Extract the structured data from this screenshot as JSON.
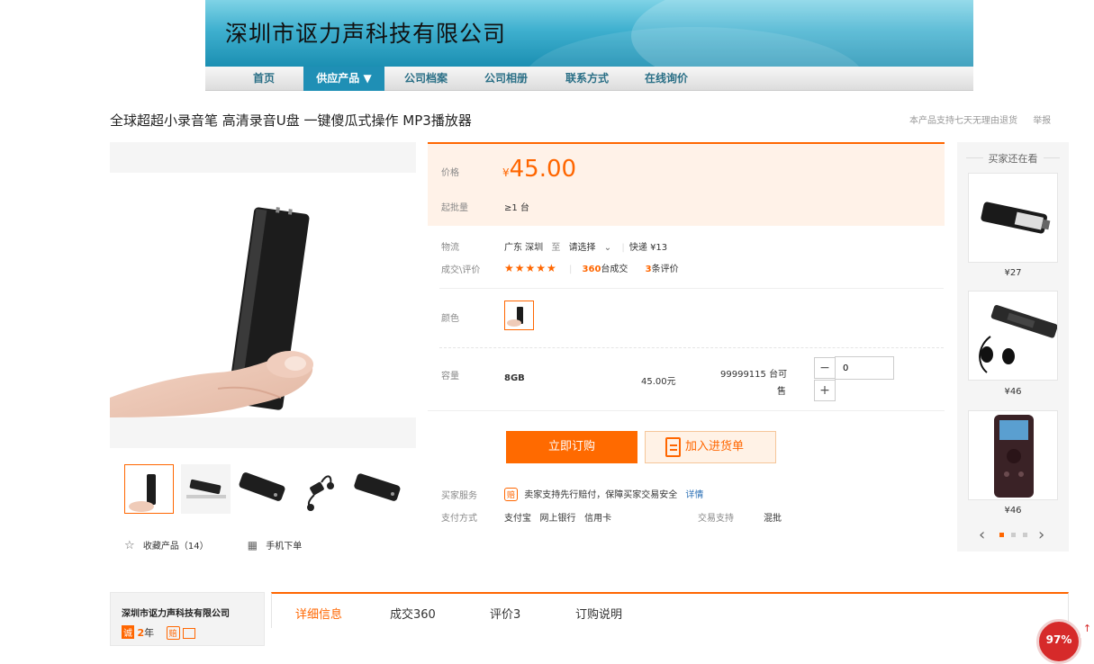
{
  "header": {
    "company_name": "深圳市讴力声科技有限公司",
    "nav": [
      {
        "label": "首页"
      },
      {
        "label": "供应产品 ▼"
      },
      {
        "label": "公司档案"
      },
      {
        "label": "公司相册"
      },
      {
        "label": "联系方式"
      },
      {
        "label": "在线询价"
      }
    ]
  },
  "product": {
    "title": "全球超超小录音笔 高清录音U盘 一键傻瓜式操作 MP3播放器",
    "return_policy": "本产品支持七天无理由退货",
    "report": "举报",
    "price_label": "价格",
    "currency": "¥",
    "price": "45.00",
    "moq_label": "起批量",
    "moq": "≥1 台",
    "logistics_label": "物流",
    "logistics_from": "广东 深圳",
    "logistics_to": "至",
    "logistics_select": "请选择",
    "shipping": "快递 ¥13",
    "deals_label": "成交\\评价",
    "stars": "★★★★★",
    "deals_count": "360",
    "deals_unit": "台成交",
    "review_count": "3",
    "review_unit": "条评价",
    "color_label": "颜色",
    "capacity_label": "容量",
    "capacity": "8GB",
    "variant_price": "45.00元",
    "stock_line1": "99999115 台可",
    "stock_line2": "售",
    "qty_minus": "−",
    "qty_plus": "+",
    "qty_value": "0",
    "buy_label": "立即订购",
    "cart_label": "加入进货单",
    "service_label": "买家服务",
    "service_badge": "赔",
    "service_text": "卖家支持先行赔付，保障买家交易安全",
    "service_link": "详情",
    "payment_label": "支付方式",
    "payment_methods": "支付宝   网上银行   信用卡",
    "trade_label": "交易支持",
    "trade_value": "混批",
    "favorite_label": "收藏产品（14）",
    "mobile_label": "手机下单"
  },
  "sidebar": {
    "title": "买家还在看",
    "items": [
      {
        "price": "¥27"
      },
      {
        "price": "¥46"
      },
      {
        "price": "¥46"
      }
    ],
    "prev": "‹",
    "next": "›"
  },
  "shop": {
    "name": "深圳市讴力声科技有限公司",
    "years_badge": "诚",
    "years": "2",
    "years_unit": "年"
  },
  "tabs": [
    {
      "label": "详细信息"
    },
    {
      "label": "成交360"
    },
    {
      "label": "评价3"
    },
    {
      "label": "订购说明"
    }
  ],
  "badge": {
    "text": "97%"
  },
  "colors": {
    "accent": "#ff6600",
    "nav_active": "#1f8fb5",
    "banner": "#3fb0cf"
  }
}
